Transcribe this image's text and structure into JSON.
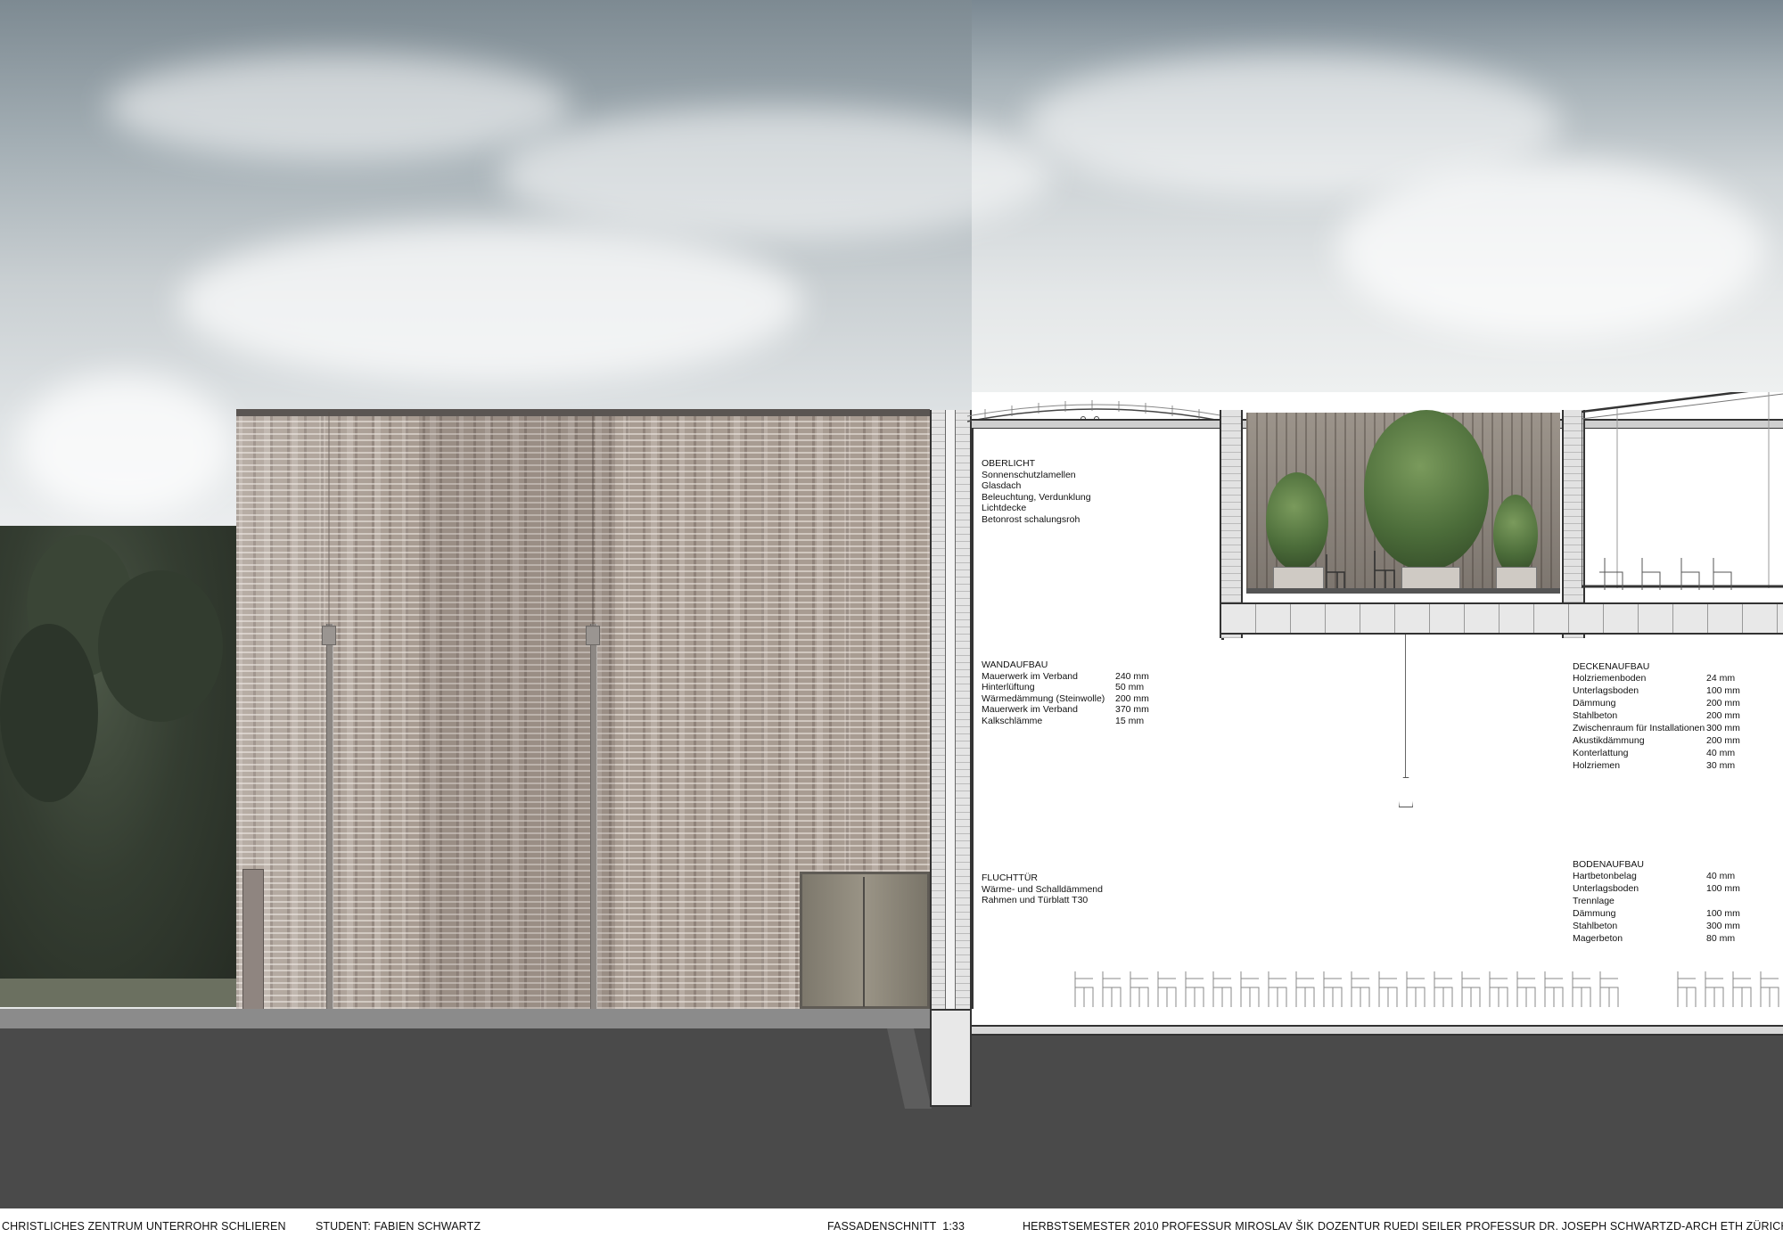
{
  "annotations": {
    "oberlicht": {
      "title": "OBERLICHT",
      "lines": [
        "Sonnenschutzlamellen",
        "Glasdach",
        "Beleuchtung, Verdunklung",
        "Lichtdecke",
        "Betonrost schalungsroh"
      ]
    },
    "wandaufbau": {
      "title": "WANDAUFBAU",
      "rows": [
        {
          "name": "Mauerwerk im Verband",
          "value": "240 mm"
        },
        {
          "name": "Hinterlüftung",
          "value": "50 mm"
        },
        {
          "name": "Wärmedämmung (Steinwolle)",
          "value": "200 mm"
        },
        {
          "name": "Mauerwerk im Verband",
          "value": "370 mm"
        },
        {
          "name": "Kalkschlämme",
          "value": "15 mm"
        }
      ]
    },
    "fluchttuer": {
      "title": "FLUCHTTÜR",
      "lines": [
        "Wärme- und Schalldämmend",
        "Rahmen und Türblatt T30"
      ]
    },
    "deckenaufbau": {
      "title": "DECKENAUFBAU",
      "rows": [
        {
          "name": "Holzriemenboden",
          "value": "24 mm"
        },
        {
          "name": "Unterlagsboden",
          "value": "100 mm"
        },
        {
          "name": "Dämmung",
          "value": "200 mm"
        },
        {
          "name": "Stahlbeton",
          "value": "200 mm"
        },
        {
          "name": "Zwischenraum für Installationen",
          "value": "300 mm"
        },
        {
          "name": "Akustikdämmung",
          "value": "200 mm"
        },
        {
          "name": "Konterlattung",
          "value": "40 mm"
        },
        {
          "name": "Holzriemen",
          "value": "30 mm"
        }
      ]
    },
    "bodenaufbau": {
      "title": "BODENAUFBAU",
      "rows": [
        {
          "name": "Hartbetonbelag",
          "value": "40 mm"
        },
        {
          "name": "Unterlagsboden",
          "value": "100 mm"
        },
        {
          "name": "Trennlage",
          "value": ""
        },
        {
          "name": "Dämmung",
          "value": "100 mm"
        },
        {
          "name": "Stahlbeton",
          "value": "300 mm"
        },
        {
          "name": "Magerbeton",
          "value": "80 mm"
        }
      ]
    }
  },
  "footer": {
    "project": "CHRISTLICHES ZENTRUM UNTERROHR SCHLIEREN",
    "student": "STUDENT: FABIEN SCHWARTZ",
    "drawing": "FASSADENSCHNITT  1:33",
    "semester": "HERBSTSEMESTER 2010",
    "professor1": "PROFESSUR MIROSLAV ŠIK",
    "dozentur": "DOZENTUR RUEDI SEILER",
    "professor2": "PROFESSUR DR. JOSEPH SCHWARTZ",
    "institution": "D-ARCH ETH ZÜRICH"
  },
  "colors": {
    "ground": "#4a4a4a",
    "brick": "#a89c92",
    "line": "#333333"
  }
}
